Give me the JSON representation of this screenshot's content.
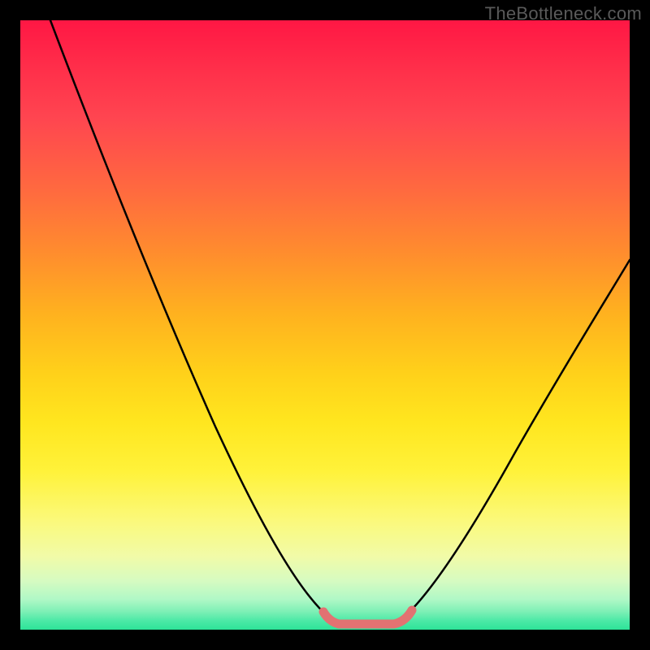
{
  "watermark": {
    "text": "TheBottleneck.com"
  },
  "colors": {
    "background": "#000000",
    "curve": "#000000",
    "flat_segment": "#e27272",
    "gradient_top": "#ff1744",
    "gradient_mid": "#ffd11a",
    "gradient_bottom": "#2de398"
  },
  "chart_data": {
    "type": "line",
    "title": "",
    "xlabel": "",
    "ylabel": "",
    "xlim": [
      0,
      100
    ],
    "ylim": [
      0,
      100
    ],
    "series": [
      {
        "name": "v-curve",
        "x": [
          5,
          10,
          15,
          20,
          25,
          30,
          35,
          40,
          45,
          48,
          50,
          54,
          57,
          60,
          63,
          66,
          70,
          75,
          80,
          85,
          90,
          95,
          100
        ],
        "y": [
          100,
          90,
          80,
          70,
          60,
          50,
          40,
          30,
          18,
          8,
          3,
          1,
          1,
          1,
          3,
          8,
          16,
          26,
          36,
          44,
          52,
          58,
          63
        ]
      }
    ],
    "annotations": [
      {
        "name": "trough-flat-segment",
        "x_range": [
          50,
          63
        ],
        "y": 1
      }
    ],
    "grid": false,
    "legend": false
  }
}
